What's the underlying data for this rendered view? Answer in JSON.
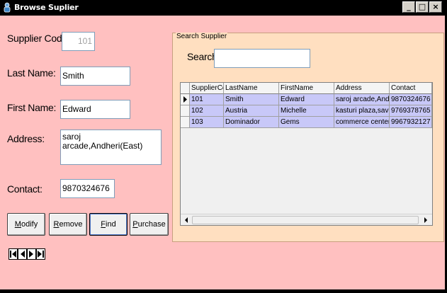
{
  "window": {
    "title": "Browse Suplier",
    "min_icon": "minimize-icon",
    "max_icon": "maximize-icon",
    "close_icon": "close-icon"
  },
  "form": {
    "supplier_code_label": "Supplier Code:",
    "supplier_code_value": "101",
    "last_name_label": "Last Name:",
    "last_name_value": "Smith",
    "first_name_label": "First Name:",
    "first_name_value": "Edward",
    "address_label": "Address:",
    "address_value": "saroj arcade,Andheri(East)",
    "contact_label": "Contact:",
    "contact_value": "9870324676"
  },
  "buttons": {
    "modify": {
      "acc": "M",
      "rest": "odify"
    },
    "remove": {
      "acc": "R",
      "rest": "emove"
    },
    "find": {
      "acc": "F",
      "rest": "ind"
    },
    "purchase": {
      "acc": "P",
      "rest": "urchase"
    }
  },
  "search": {
    "group_title": "Search Supplier",
    "label": "Search:",
    "value": ""
  },
  "grid": {
    "columns": [
      "SupplierCode",
      "LastName",
      "FirstName",
      "Address",
      "Contact"
    ],
    "rows": [
      [
        "101",
        "Smith",
        "Edward",
        "saroj arcade,Andheri(Ea",
        "9870324676"
      ],
      [
        "102",
        "Austria",
        "Michelle",
        "kasturi plaza,savarkar m",
        "9769378765"
      ],
      [
        "103",
        "Dominador",
        "Gems",
        "commerce center,near c",
        "9967932127"
      ]
    ]
  },
  "colors": {
    "background": "#ffc0c0",
    "group_background": "#ffdfc0",
    "row_highlight": "#c8c8f8",
    "titlebar": "#000000"
  }
}
